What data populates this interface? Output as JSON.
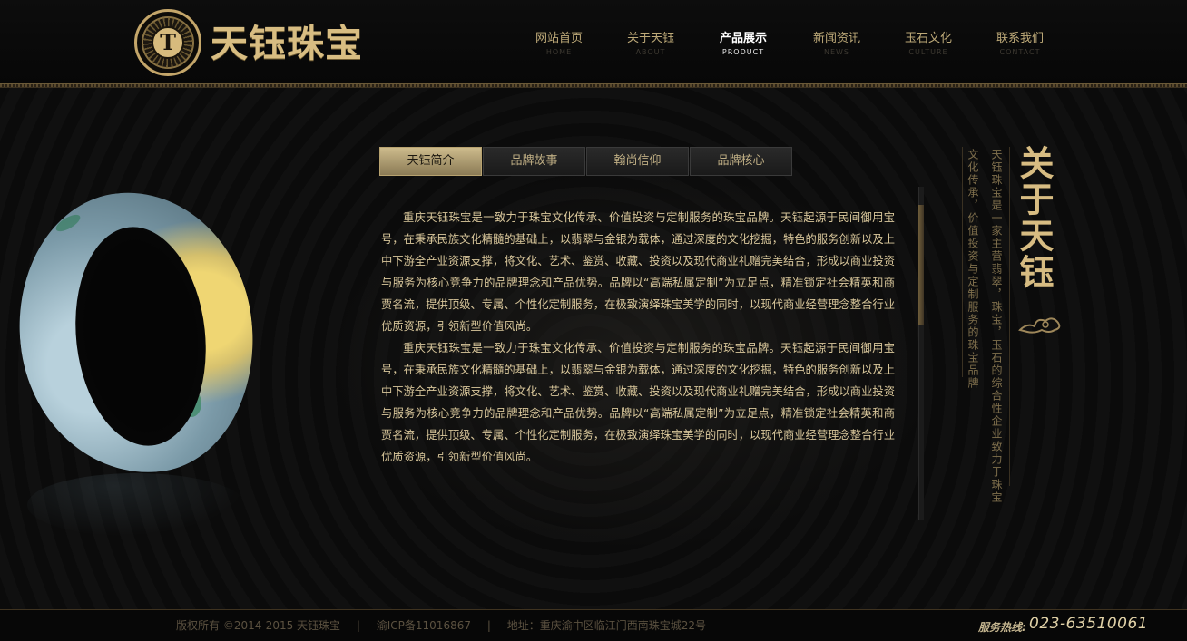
{
  "brand": {
    "name": "天钰珠宝",
    "emblem_letter": "T"
  },
  "nav": [
    {
      "cn": "网站首页",
      "en": "HOME",
      "active": false
    },
    {
      "cn": "关于天钰",
      "en": "ABOUT",
      "active": false
    },
    {
      "cn": "产品展示",
      "en": "PRODUCT",
      "active": true
    },
    {
      "cn": "新闻资讯",
      "en": "NEWS",
      "active": false
    },
    {
      "cn": "玉石文化",
      "en": "CULTURE",
      "active": false
    },
    {
      "cn": "联系我们",
      "en": "CONTACT",
      "active": false
    }
  ],
  "tabs": [
    {
      "label": "天钰简介",
      "active": true
    },
    {
      "label": "品牌故事",
      "active": false
    },
    {
      "label": "翰尚信仰",
      "active": false
    },
    {
      "label": "品牌核心",
      "active": false
    }
  ],
  "content": {
    "paragraphs": [
      "重庆天钰珠宝是一致力于珠宝文化传承、价值投资与定制服务的珠宝品牌。天钰起源于民间御用宝号，在秉承民族文化精髓的基础上，以翡翠与金银为载体，通过深度的文化挖掘，特色的服务创新以及上中下游全产业资源支撑，将文化、艺术、鉴赏、收藏、投资以及现代商业礼赠完美结合，形成以商业投资与服务为核心竞争力的品牌理念和产品优势。品牌以“高端私属定制”为立足点，精准锁定社会精英和商贾名流，提供顶级、专属、个性化定制服务，在极致演绎珠宝美学的同时，以现代商业经营理念整合行业优质资源，引领新型价值风尚。",
      "重庆天钰珠宝是一致力于珠宝文化传承、价值投资与定制服务的珠宝品牌。天钰起源于民间御用宝号，在秉承民族文化精髓的基础上，以翡翠与金银为载体，通过深度的文化挖掘，特色的服务创新以及上中下游全产业资源支撑，将文化、艺术、鉴赏、收藏、投资以及现代商业礼赠完美结合，形成以商业投资与服务为核心竞争力的品牌理念和产品优势。品牌以“高端私属定制”为立足点，精准锁定社会精英和商贾名流，提供顶级、专属、个性化定制服务，在极致演绎珠宝美学的同时，以现代商业经营理念整合行业优质资源，引领新型价值风尚。"
    ]
  },
  "sidebar": {
    "title": "关于天钰",
    "line1": "天钰珠宝是一家主营翡翠，珠宝，玉石的综合性企业致力于珠宝",
    "line2": "文化传承，价值投资与定制服务的珠宝品牌"
  },
  "footer": {
    "copyright": "版权所有 ©2014-2015 天钰珠宝",
    "separator": "|",
    "icp": "渝ICP备11016867",
    "address": "地址：重庆渝中区临江门西南珠宝城22号",
    "hotline_label": "服务热线:",
    "hotline_number": "023-63510061"
  }
}
